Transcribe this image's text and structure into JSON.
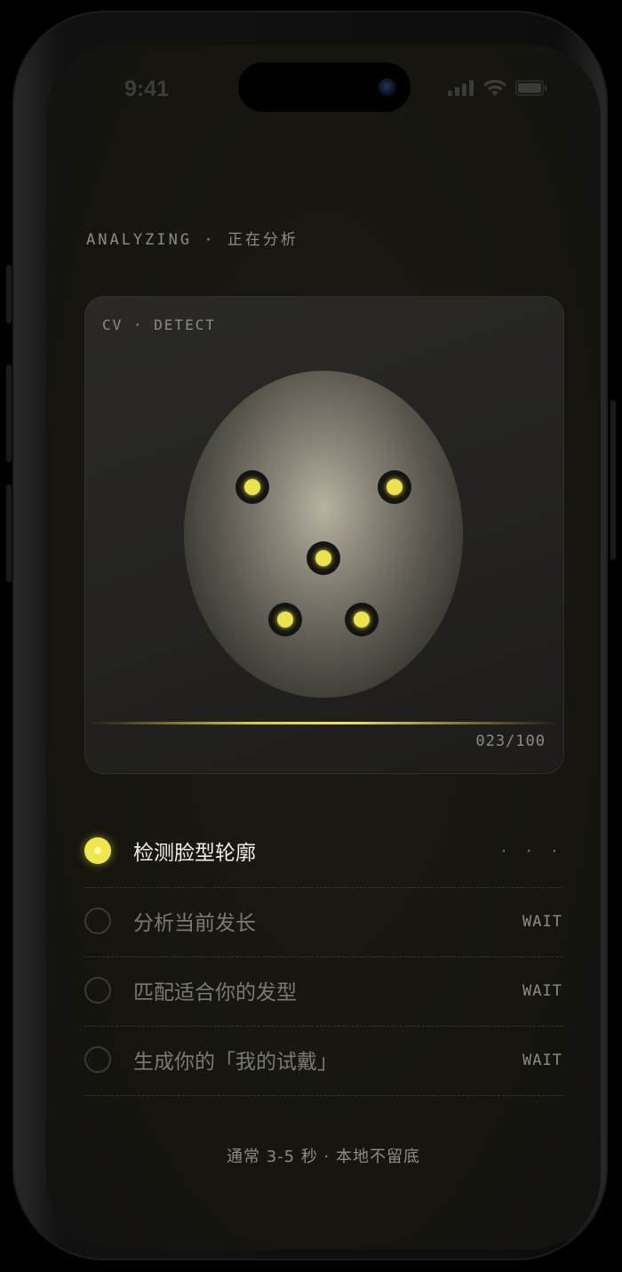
{
  "status_bar": {
    "time": "9:41",
    "icons": [
      "cellular-signal-icon",
      "wifi-icon",
      "battery-icon"
    ]
  },
  "header": {
    "title": "ANALYZING · 正在分析"
  },
  "detect_card": {
    "tag": "CV · DETECT",
    "progress_label": "023/100",
    "progress": {
      "current": 23,
      "total": 100
    },
    "landmarks": [
      "left-eye",
      "right-eye",
      "nose",
      "left-mouth-corner",
      "right-mouth-corner"
    ]
  },
  "steps": [
    {
      "label": "检测脸型轮廓",
      "status": "· · ·",
      "state": "active"
    },
    {
      "label": "分析当前发长",
      "status": "WAIT",
      "state": "pending"
    },
    {
      "label": "匹配适合你的发型",
      "status": "WAIT",
      "state": "pending"
    },
    {
      "label": "生成你的「我的试戴」",
      "status": "WAIT",
      "state": "pending"
    }
  ],
  "footer": {
    "note": "通常 3-5 秒 · 本地不留底"
  },
  "colors": {
    "accent": "#f0e64e",
    "background": "#16150f",
    "card": "#252422",
    "muted_text": "#8c8b84"
  }
}
